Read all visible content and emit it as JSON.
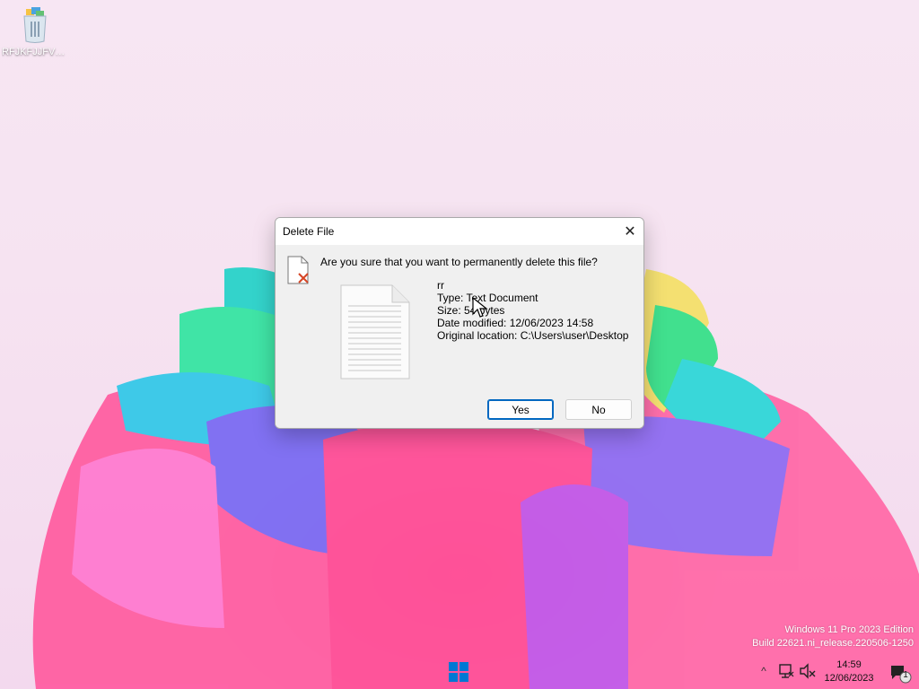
{
  "desktop": {
    "icon_label": "RFJKFJJFVD..."
  },
  "dialog": {
    "title": "Delete File",
    "close_symbol": "✕",
    "question": "Are you sure that you want to permanently delete this file?",
    "file_name": "rr",
    "type_line": "Type: Text Document",
    "size_line": "Size: 54 bytes",
    "date_line": "Date modified: 12/06/2023 14:58",
    "location_line": "Original location: C:\\Users\\user\\Desktop",
    "yes_label": "Yes",
    "no_label": "No"
  },
  "watermark": {
    "line1": "Windows 11 Pro 2023 Edition",
    "line2": "Build 22621.ni_release.220506-1250"
  },
  "taskbar": {
    "start_icon": "windows-logo-icon",
    "chevron": "^",
    "time": "14:59",
    "date": "12/06/2023",
    "notification_count": "1"
  },
  "colors": {
    "accent": "#0067c0",
    "start_blue": "#0078d4"
  }
}
